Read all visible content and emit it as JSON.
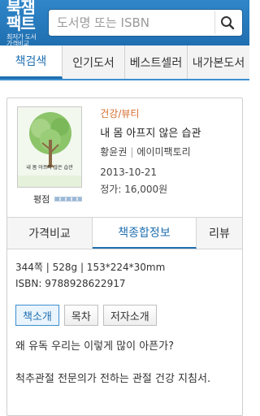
{
  "header": {
    "logo_main": "북잼팩트",
    "logo_sub": "최저가 도서가격비교",
    "search_placeholder": "도서명 또는 ISBN"
  },
  "tabs": [
    {
      "label": "책검색",
      "active": true
    },
    {
      "label": "인기도서",
      "active": false
    },
    {
      "label": "베스트셀러",
      "active": false
    },
    {
      "label": "내가본도서",
      "active": false
    }
  ],
  "book": {
    "category": "건강/뷰티",
    "title": "내 몸 아프지 않은 습관",
    "author": "황윤권",
    "publisher": "에이미팩토리",
    "date": "2013-10-21",
    "price": "정가: 16,000원",
    "cover_title": "내 몸 아프지 않은 습관",
    "rating_label": "평점"
  },
  "subtabs": [
    {
      "label": "가격비교",
      "active": false
    },
    {
      "label": "책종합정보",
      "active": true
    },
    {
      "label": "리뷰",
      "active": false
    }
  ],
  "details": {
    "specs": "344쪽 | 528g | 153*224*30mm",
    "isbn": "ISBN: 9788928622917"
  },
  "section_buttons": [
    {
      "label": "책소개",
      "active": true
    },
    {
      "label": "목차",
      "active": false
    },
    {
      "label": "저자소개",
      "active": false
    }
  ],
  "description": {
    "line1": "왜 유독 우리는 이렇게 많이 아픈가?",
    "line2": "척추관절 전문의가 전하는 관절 건강 지침서."
  }
}
